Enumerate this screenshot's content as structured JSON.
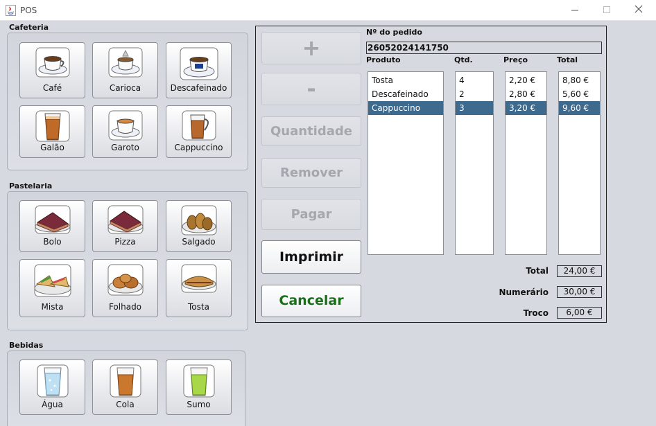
{
  "window": {
    "title": "POS"
  },
  "sections": {
    "cafeteria": "Cafeteria",
    "pastelaria": "Pastelaria",
    "bebidas": "Bebidas"
  },
  "products": {
    "cafeteria": [
      "Café",
      "Carioca",
      "Descafeinado",
      "Galão",
      "Garoto",
      "Cappuccino"
    ],
    "pastelaria": [
      "Bolo",
      "Pizza",
      "Salgado",
      "Mista",
      "Folhado",
      "Tosta"
    ],
    "bebidas": [
      "Água",
      "Cola",
      "Sumo"
    ]
  },
  "actions": {
    "plus": "+",
    "minus": "-",
    "quantidade": "Quantidade",
    "remover": "Remover",
    "pagar": "Pagar",
    "imprimir": "Imprimir",
    "cancelar": "Cancelar"
  },
  "order": {
    "number_label": "Nº do pedido",
    "number": "26052024141750",
    "headers": {
      "produto": "Produto",
      "qtd": "Qtd.",
      "preco": "Preço",
      "total": "Total"
    },
    "items": [
      {
        "produto": "Tosta",
        "qtd": "4",
        "preco": "2,20 €",
        "total": "8,80 €"
      },
      {
        "produto": "Descafeinado",
        "qtd": "2",
        "preco": "2,80 €",
        "total": "5,60 €"
      },
      {
        "produto": "Cappuccino",
        "qtd": "3",
        "preco": "3,20 €",
        "total": "9,60 €"
      }
    ],
    "selected_row": 2
  },
  "summary": {
    "total_label": "Total",
    "total": "24,00 €",
    "numerario_label": "Numerário",
    "numerario": "30,00 €",
    "troco_label": "Troco",
    "troco": "6,00 €"
  },
  "colors": {
    "selection": "#3e6a8e",
    "cancel_text": "#1a6e1a"
  }
}
